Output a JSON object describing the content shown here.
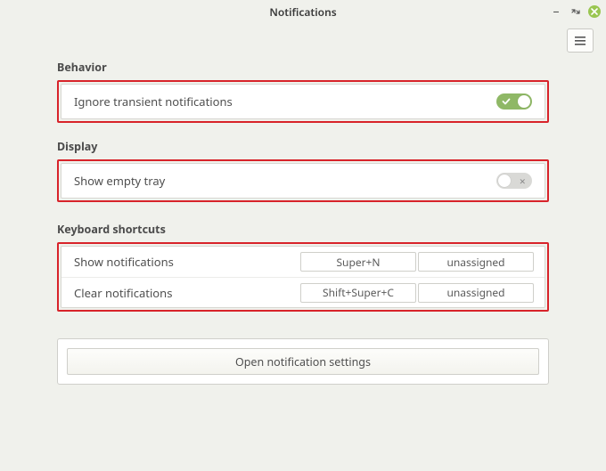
{
  "window": {
    "title": "Notifications"
  },
  "sections": {
    "behavior": {
      "title": "Behavior",
      "ignore_transient": {
        "label": "Ignore transient notifications",
        "on": true
      }
    },
    "display": {
      "title": "Display",
      "show_empty_tray": {
        "label": "Show empty tray",
        "on": false
      }
    },
    "shortcuts": {
      "title": "Keyboard shortcuts",
      "rows": [
        {
          "name": "Show notifications",
          "binding1": "Super+N",
          "binding2": "unassigned"
        },
        {
          "name": "Clear notifications",
          "binding1": "Shift+Super+C",
          "binding2": "unassigned"
        }
      ]
    }
  },
  "footer": {
    "open_settings": "Open notification settings"
  }
}
